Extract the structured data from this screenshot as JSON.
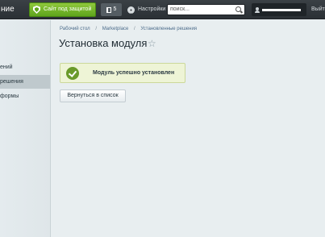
{
  "topbar": {
    "brand_label": "ние",
    "protected_label": "Сайт под защитой",
    "notifications_count": "5",
    "settings_label": "Настройки",
    "search_value": "поиск...",
    "logout_label": "Выйт"
  },
  "sidebar": {
    "items": [
      {
        "label": "ений"
      },
      {
        "label": "решения"
      },
      {
        "label": "формы"
      }
    ]
  },
  "breadcrumb": [
    "Рабочий стол",
    "Marketplace",
    "Установленные решения"
  ],
  "page": {
    "title": "Установка модуля",
    "success_message": "Модуль успешно установлен",
    "back_button": "Вернуться в список"
  },
  "colors": {
    "topbar": "#2b3035",
    "protected_green": "#5ea41c",
    "success_bg": "#eef4d6",
    "check_green": "#6a9a2a"
  }
}
